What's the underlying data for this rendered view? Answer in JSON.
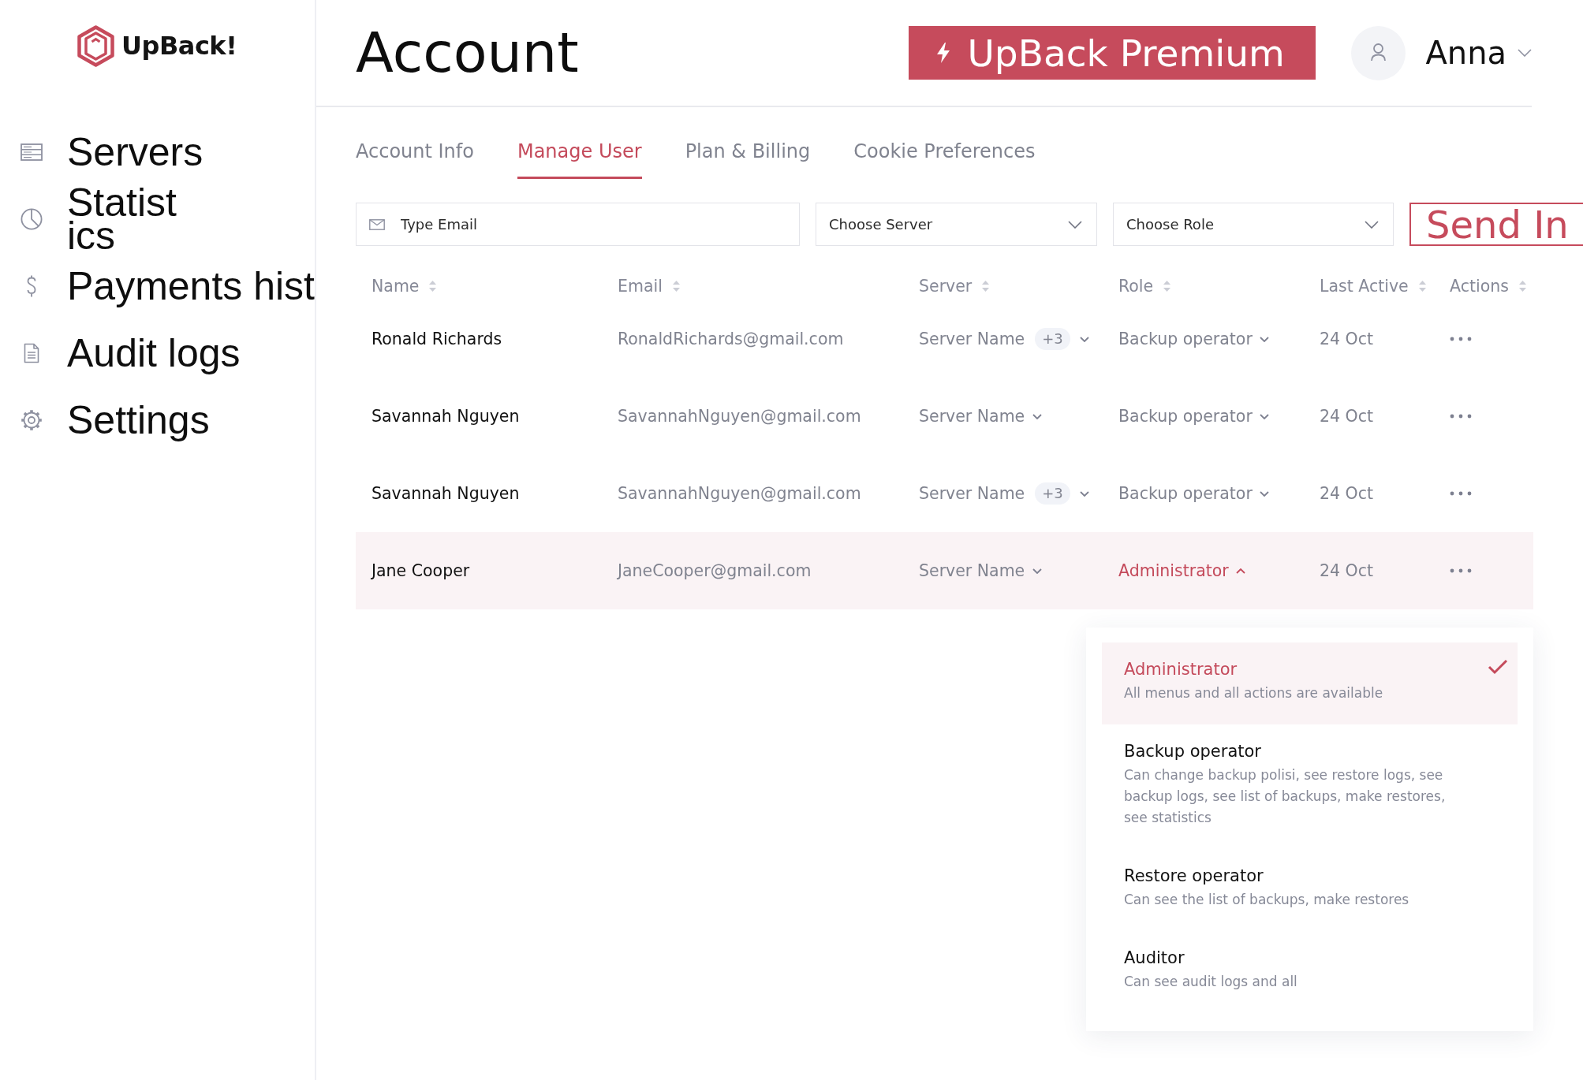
{
  "sidebar": {
    "logo": {
      "text": "UpBack!"
    },
    "items": [
      {
        "label": "Servers"
      },
      {
        "label": "Statistics"
      },
      {
        "label": "Payments hist"
      },
      {
        "label": "Audit logs"
      },
      {
        "label": "Settings"
      }
    ]
  },
  "header": {
    "title": "Account",
    "premium_button": {
      "label": "UpBack Premium"
    },
    "user": {
      "name": "Anna"
    }
  },
  "tabs": [
    {
      "label": "Account Info",
      "selected": false
    },
    {
      "label": "Manage User",
      "selected": true
    },
    {
      "label": "Plan & Billing",
      "selected": false
    },
    {
      "label": "Cookie Preferences",
      "selected": false
    }
  ],
  "filters": {
    "email_field": {
      "placeholder": "Type Email"
    },
    "server_select": {
      "placeholder": "Choose Server"
    },
    "role_select": {
      "placeholder": "Choose Role"
    },
    "invite_button": {
      "label": "Send In"
    }
  },
  "table": {
    "columns": [
      "Name",
      "Email",
      "Server",
      "Role",
      "Last Active",
      "Actions"
    ],
    "rows": [
      {
        "name": "Ronald Richards",
        "email": "RonaldRichards@gmail.com",
        "server": "Server Name",
        "server_extra": "+3",
        "role": "Backup operator",
        "role_expanded": false,
        "last_active": "24 Oct",
        "selected": false
      },
      {
        "name": "Savannah Nguyen",
        "email": "SavannahNguyen@gmail.com",
        "server": "Server Name",
        "role": "Backup operator",
        "role_expanded": false,
        "last_active": "24 Oct",
        "selected": false
      },
      {
        "name": "Savannah Nguyen",
        "email": "SavannahNguyen@gmail.com",
        "server": "Server Name",
        "server_extra": "+3",
        "role": "Backup operator",
        "role_expanded": false,
        "last_active": "24 Oct",
        "selected": false
      },
      {
        "name": "Jane Cooper",
        "email": "JaneCooper@gmail.com",
        "server": "Server Name",
        "role": "Administrator",
        "role_expanded": true,
        "last_active": "24 Oct",
        "selected": true
      }
    ]
  },
  "role_menu": {
    "options": [
      {
        "title": "Administrator",
        "description": "All menus and all actions are available",
        "selected": true
      },
      {
        "title": "Backup operator",
        "description": "Can change backup polisi, see restore logs, see backup logs, see list of backups, make restores, see statistics",
        "selected": false
      },
      {
        "title": "Restore operator",
        "description": "Can see the list of backups, make restores",
        "selected": false
      },
      {
        "title": "Auditor",
        "description": "Can see audit logs and all",
        "selected": false
      }
    ]
  }
}
